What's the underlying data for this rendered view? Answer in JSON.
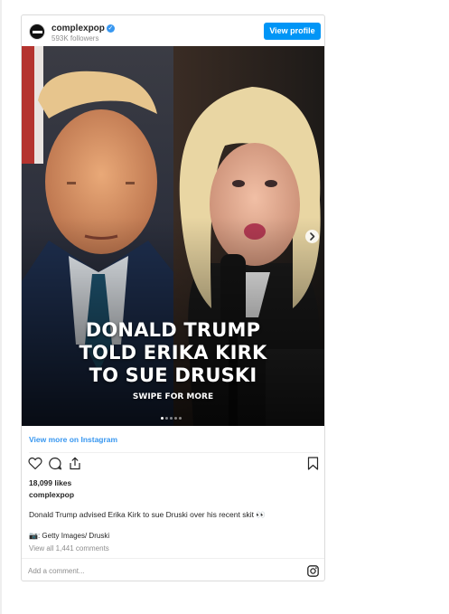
{
  "colors": {
    "accent": "#0095f6",
    "link": "#3897f0",
    "text": "#262626",
    "muted": "#8e8e8e"
  },
  "header": {
    "username": "complexpop",
    "followers": "593K followers",
    "verified_icon": "verified-badge-icon",
    "view_profile_label": "View profile"
  },
  "media": {
    "headline_lines": [
      "DONALD TRUMP",
      "TOLD ERIKA KIRK",
      "TO SUE DRUSKI"
    ],
    "swipe_text": "SWIPE FOR MORE",
    "slide_count": 5,
    "active_slide": 1,
    "next_icon": "chevron-right-icon"
  },
  "view_more_label": "View more on Instagram",
  "actions": {
    "icons": [
      "heart-icon",
      "comment-icon",
      "share-icon",
      "bookmark-icon"
    ]
  },
  "likes": "18,099 likes",
  "owner": "complexpop",
  "caption": "Donald Trump advised Erika Kirk to sue Druski over his recent skit 👀",
  "credit": "📷: Getty Images/ Druski",
  "comments_link": "View all 1,441 comments",
  "comment_placeholder": "Add a comment...",
  "instagram_icon": "instagram-icon"
}
